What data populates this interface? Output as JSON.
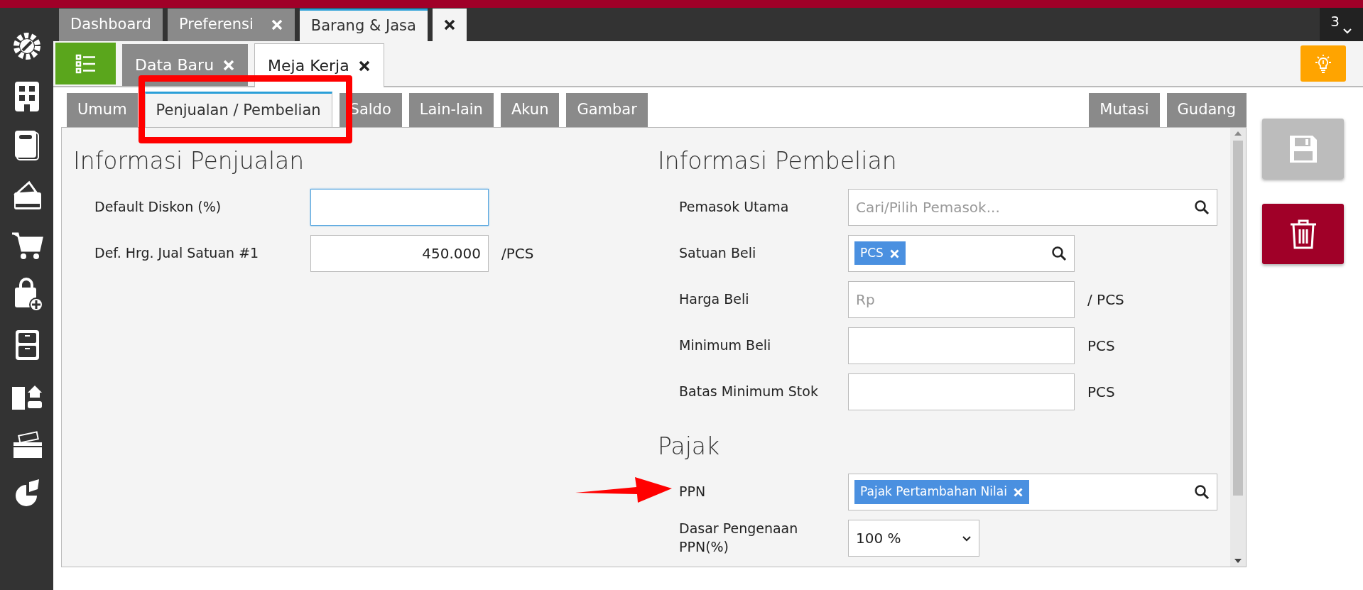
{
  "top_tabs": [
    {
      "label": "Dashboard",
      "closable": false,
      "selected": false
    },
    {
      "label": "Preferensi",
      "closable": true,
      "selected": false
    },
    {
      "label": "Barang & Jasa",
      "closable": true,
      "selected": true
    }
  ],
  "tab_counter": "3",
  "doc_tabs": [
    {
      "label": "Data Baru",
      "selected": false
    },
    {
      "label": "Meja Kerja",
      "selected": true
    }
  ],
  "section_tabs": [
    {
      "label": "Umum",
      "selected": false
    },
    {
      "label": "Penjualan / Pembelian",
      "selected": true
    },
    {
      "label": "Saldo",
      "selected": false
    },
    {
      "label": "Lain-lain",
      "selected": false
    },
    {
      "label": "Akun",
      "selected": false
    },
    {
      "label": "Gambar",
      "selected": false
    }
  ],
  "side_tabs": [
    {
      "label": "Mutasi",
      "selected": false
    },
    {
      "label": "Gudang",
      "selected": false
    }
  ],
  "penjualan": {
    "title": "Informasi Penjualan",
    "fields": [
      {
        "kind": "text",
        "label": "Default Diskon (%)",
        "focused": true
      },
      {
        "kind": "number",
        "label": "Def. Hrg. Jual Satuan #1",
        "value": "450.000",
        "unit": "/PCS",
        "focused": false
      }
    ]
  },
  "pembelian": {
    "title": "Informasi Pembelian",
    "fields": [
      {
        "kind": "search",
        "label": "Pemasok Utama",
        "placeholder": "Cari/Pilih Pemasok..."
      },
      {
        "kind": "unit",
        "label": "Satuan Beli",
        "tags": [
          "PCS"
        ]
      },
      {
        "kind": "text",
        "label": "Harga Beli",
        "placeholder": "Rp",
        "unit": "/ PCS"
      },
      {
        "kind": "text",
        "label": "Minimum Beli",
        "unit": "PCS"
      },
      {
        "kind": "text",
        "label": "Batas Minimum Stok",
        "unit": "PCS"
      }
    ]
  },
  "pajak": {
    "title": "Pajak",
    "fields": [
      {
        "kind": "tags",
        "label": "PPN",
        "tags": [
          "Pajak Pertambahan Nilai"
        ]
      },
      {
        "kind": "select",
        "label": "Dasar Pengenaan PPN(%)",
        "value": "100 %"
      }
    ]
  }
}
